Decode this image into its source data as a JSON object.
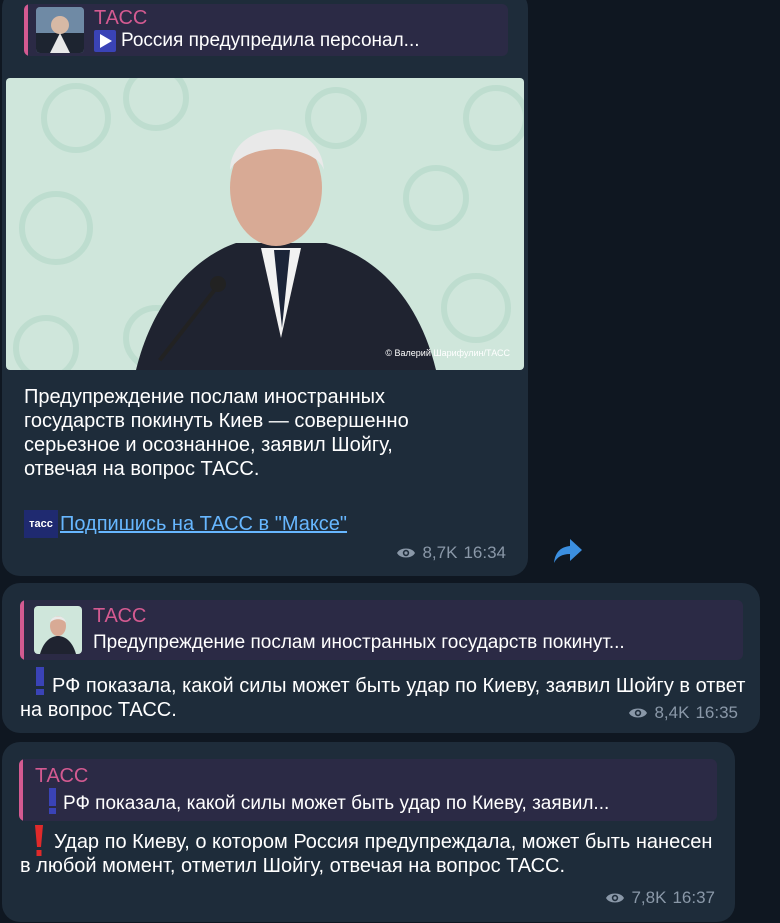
{
  "messages": [
    {
      "reply": {
        "name": "ТАСС",
        "snippet": "Россия предупредила персонал..."
      },
      "photo": {
        "credit": "© Валерий Шарифулин/ТАСС"
      },
      "text": "Предупреждение послам иностранных государств покинуть Киев — совершенно серьезное и осознанное, заявил Шойгу, отвечая на вопрос ТАСС.",
      "promo": {
        "logo": "тасс",
        "link": "Подпишись на ТАСС в \"Максе\""
      },
      "views": "8,7K",
      "time": "16:34"
    },
    {
      "reply": {
        "name": "ТАСС",
        "snippet": "Предупреждение послам иностранных государств покинут..."
      },
      "text": "РФ показала, какой силы может быть удар по Киеву, заявил Шойгу в ответ на вопрос ТАСС.",
      "views": "8,4K",
      "time": "16:35"
    },
    {
      "reply": {
        "name": "ТАСС",
        "snippet": "РФ показала, какой силы может быть удар по Киеву, заявил..."
      },
      "text": "Удар по Киеву, о котором Россия предупреждала, может быть нанесен в любой момент, отметил Шойгу, отвечая на вопрос ТАСС.",
      "views": "7,8K",
      "time": "16:37"
    }
  ],
  "colors": {
    "accent_name": "#d45a91",
    "link": "#67b7ff",
    "bubble": "#1e2c3a",
    "background": "#0f1721"
  },
  "icons": [
    "play-icon",
    "exclamation-icon",
    "eye-icon",
    "share-icon"
  ]
}
